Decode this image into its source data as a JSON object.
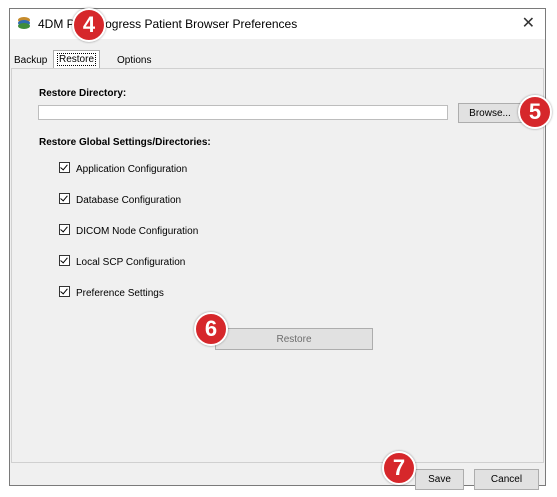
{
  "window": {
    "title": "4DM PET Progress Patient Browser Preferences",
    "close_label": "✕"
  },
  "tabs": [
    {
      "label": "Backup"
    },
    {
      "label": "Restore",
      "active": true
    },
    {
      "label": "Options"
    }
  ],
  "restore": {
    "directory_label": "Restore Directory:",
    "directory_value": "",
    "browse_label": "Browse...",
    "global_label": "Restore Global Settings/Directories:",
    "checks": [
      {
        "label": "Application Configuration",
        "checked": true
      },
      {
        "label": "Database Configuration",
        "checked": true
      },
      {
        "label": "DICOM Node Configuration",
        "checked": true
      },
      {
        "label": "Local SCP Configuration",
        "checked": true
      },
      {
        "label": "Preference Settings",
        "checked": true
      }
    ],
    "restore_button": "Restore"
  },
  "footer": {
    "save_label": "Save",
    "cancel_label": "Cancel"
  },
  "callouts": [
    "4",
    "5",
    "6",
    "7"
  ],
  "colors": {
    "callout_red": "#d6272b",
    "window_bg": "#f0f0f0"
  },
  "icons": {
    "app": "app-logo-icon",
    "close": "close-icon"
  }
}
